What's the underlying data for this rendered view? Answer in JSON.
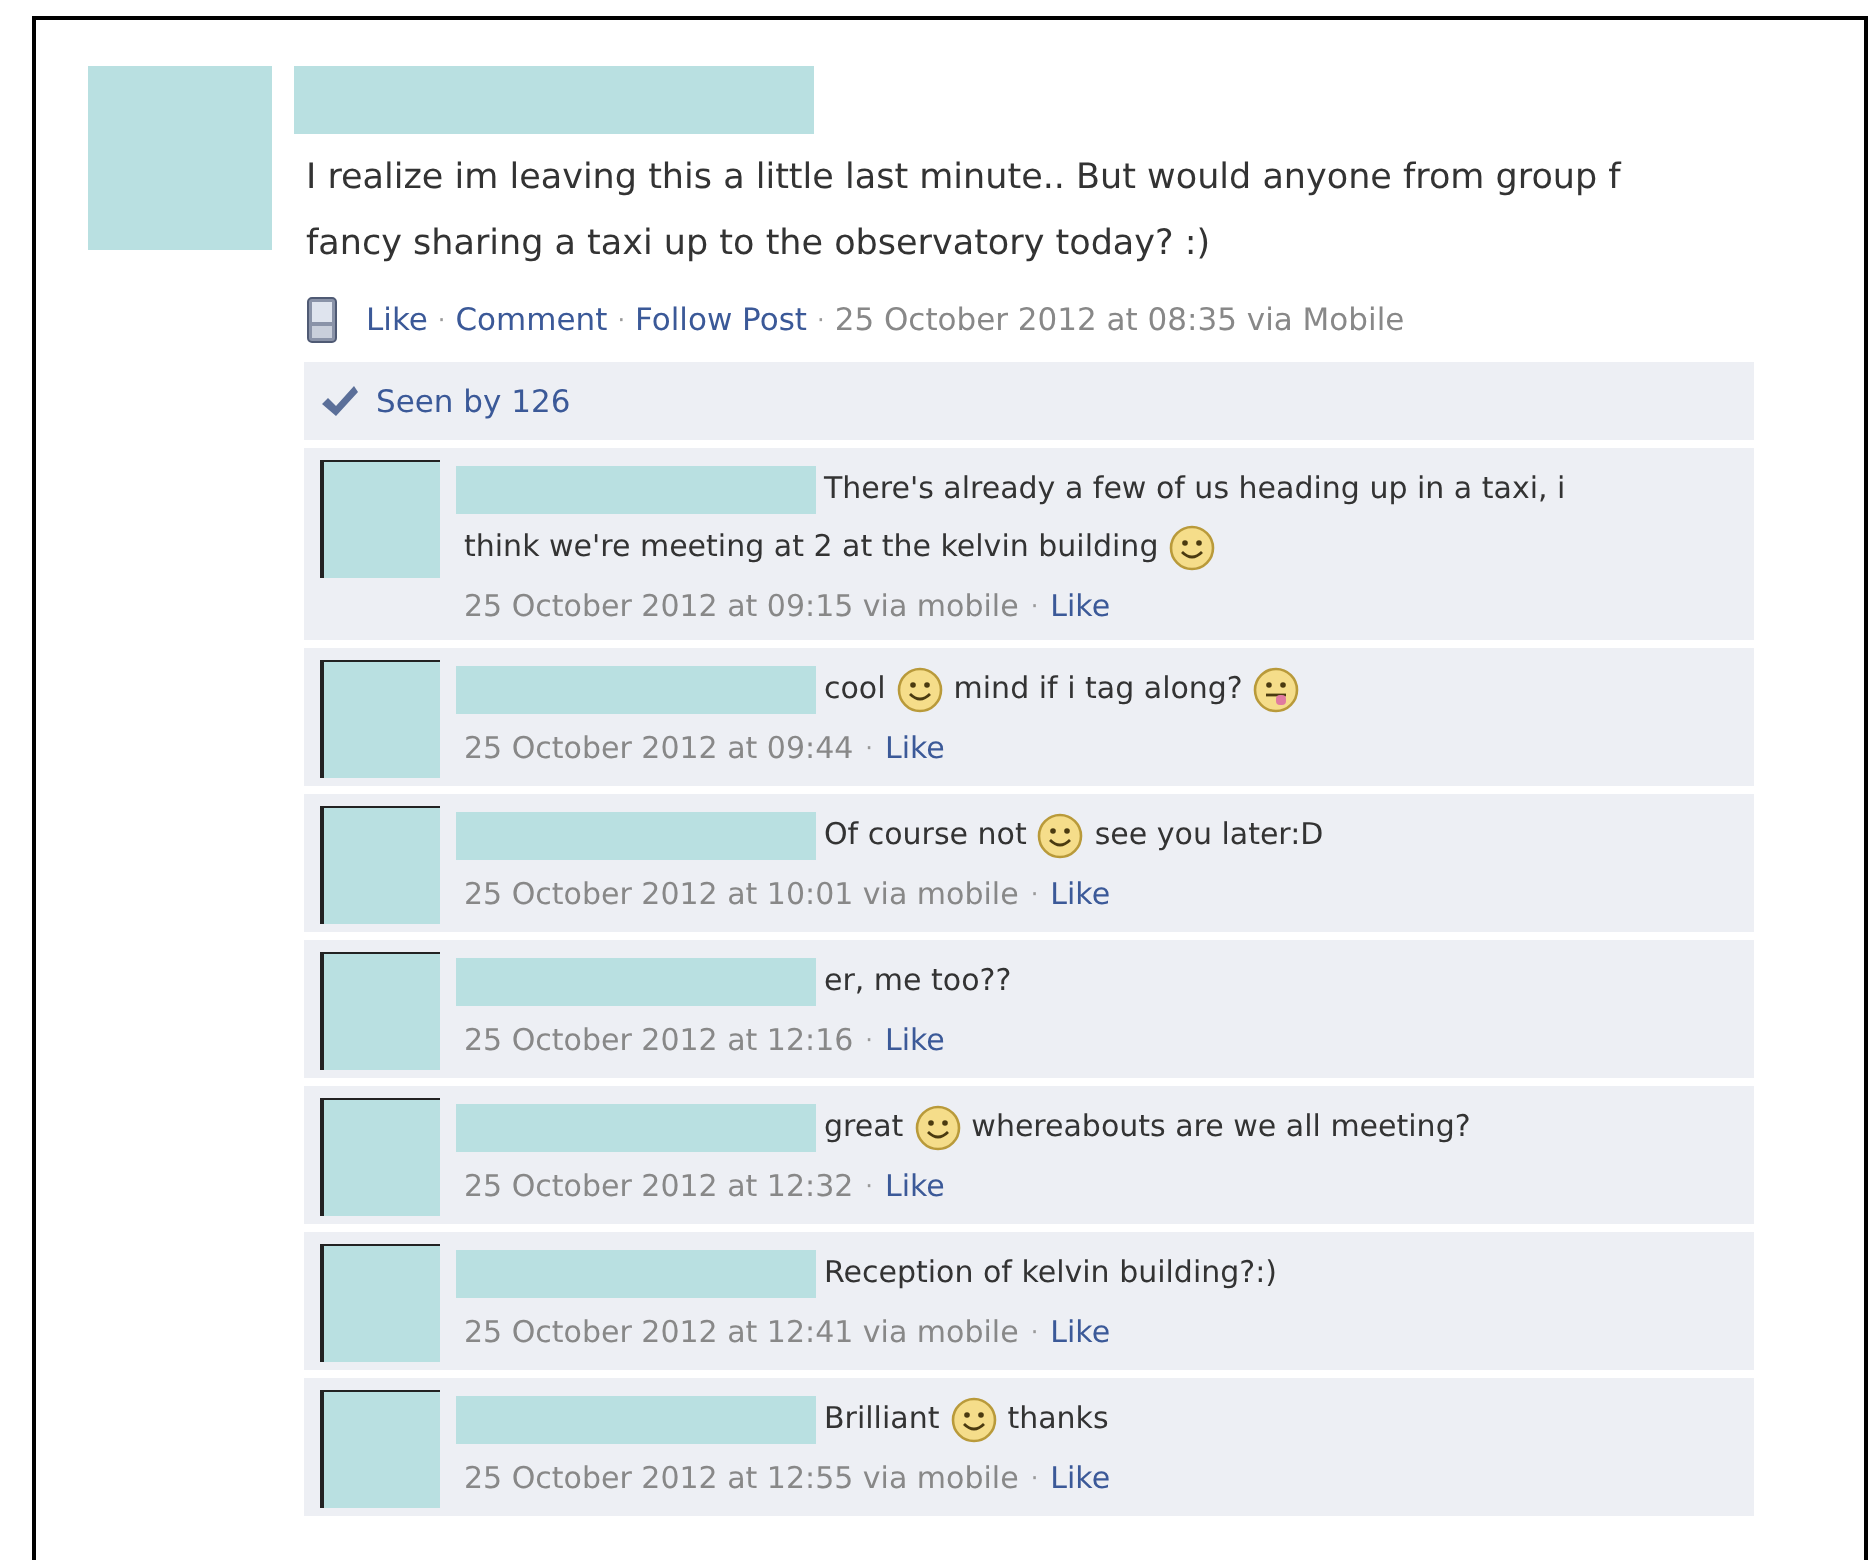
{
  "post": {
    "author_redacted": true,
    "message": "I realize im leaving this a little last minute.. But would anyone from group f fancy sharing a taxi up to the observatory today? :)",
    "action_line": [
      {
        "kind": "link",
        "text": "Like"
      },
      {
        "kind": "sep",
        "text": "·"
      },
      {
        "kind": "link",
        "text": "Comment"
      },
      {
        "kind": "sep",
        "text": "·"
      },
      {
        "kind": "link",
        "text": "Follow Post"
      },
      {
        "kind": "sep",
        "text": "·"
      },
      {
        "kind": "time",
        "text": "25 October 2012 at 08:35 via Mobile"
      }
    ],
    "seen_by": "Seen by 126"
  },
  "comments": [
    {
      "name_redacted": true,
      "text": [
        {
          "kind": "text",
          "text": "There's already a few of us heading up in a taxi, i"
        },
        {
          "kind": "break"
        },
        {
          "kind": "text",
          "text": "think we're meeting at 2 at the kelvin building"
        },
        {
          "kind": "smile_emoji"
        }
      ],
      "meta": [
        {
          "kind": "time",
          "text": "25 October 2012 at 09:15 via mobile"
        },
        {
          "kind": "sep",
          "text": "·"
        },
        {
          "kind": "link",
          "text": "Like"
        }
      ]
    },
    {
      "name_redacted": true,
      "text": [
        {
          "kind": "text",
          "text": "cool"
        },
        {
          "kind": "smile_emoji"
        },
        {
          "kind": "text",
          "text": "mind if i tag along?"
        },
        {
          "kind": "tongue_emoji"
        }
      ],
      "meta": [
        {
          "kind": "time",
          "text": "25 October 2012 at 09:44"
        },
        {
          "kind": "sep",
          "text": "·"
        },
        {
          "kind": "link",
          "text": "Like"
        }
      ]
    },
    {
      "name_redacted": true,
      "text": [
        {
          "kind": "text",
          "text": "Of course not"
        },
        {
          "kind": "smile_emoji"
        },
        {
          "kind": "text",
          "text": "see you later:D"
        }
      ],
      "meta": [
        {
          "kind": "time",
          "text": "25 October 2012 at 10:01 via mobile"
        },
        {
          "kind": "sep",
          "text": "·"
        },
        {
          "kind": "link",
          "text": "Like"
        }
      ]
    },
    {
      "name_redacted": true,
      "text": [
        {
          "kind": "text",
          "text": "er, me too??"
        }
      ],
      "meta": [
        {
          "kind": "time",
          "text": "25 October 2012 at 12:16"
        },
        {
          "kind": "sep",
          "text": "·"
        },
        {
          "kind": "link",
          "text": "Like"
        }
      ]
    },
    {
      "name_redacted": true,
      "text": [
        {
          "kind": "text",
          "text": "great"
        },
        {
          "kind": "smile_emoji"
        },
        {
          "kind": "text",
          "text": "whereabouts are we all meeting?"
        }
      ],
      "meta": [
        {
          "kind": "time",
          "text": "25 October 2012 at 12:32"
        },
        {
          "kind": "sep",
          "text": "·"
        },
        {
          "kind": "link",
          "text": "Like"
        }
      ]
    },
    {
      "name_redacted": true,
      "text": [
        {
          "kind": "text",
          "text": "Reception of kelvin building?:)"
        }
      ],
      "meta": [
        {
          "kind": "time",
          "text": "25 October 2012 at 12:41 via mobile"
        },
        {
          "kind": "sep",
          "text": "·"
        },
        {
          "kind": "link",
          "text": "Like"
        }
      ]
    },
    {
      "name_redacted": true,
      "text": [
        {
          "kind": "text",
          "text": "Brilliant"
        },
        {
          "kind": "smile_emoji"
        },
        {
          "kind": "text",
          "text": "thanks"
        }
      ],
      "meta": [
        {
          "kind": "time",
          "text": "25 October 2012 at 12:55 via mobile"
        },
        {
          "kind": "sep",
          "text": "·"
        },
        {
          "kind": "link",
          "text": "Like"
        }
      ]
    }
  ]
}
